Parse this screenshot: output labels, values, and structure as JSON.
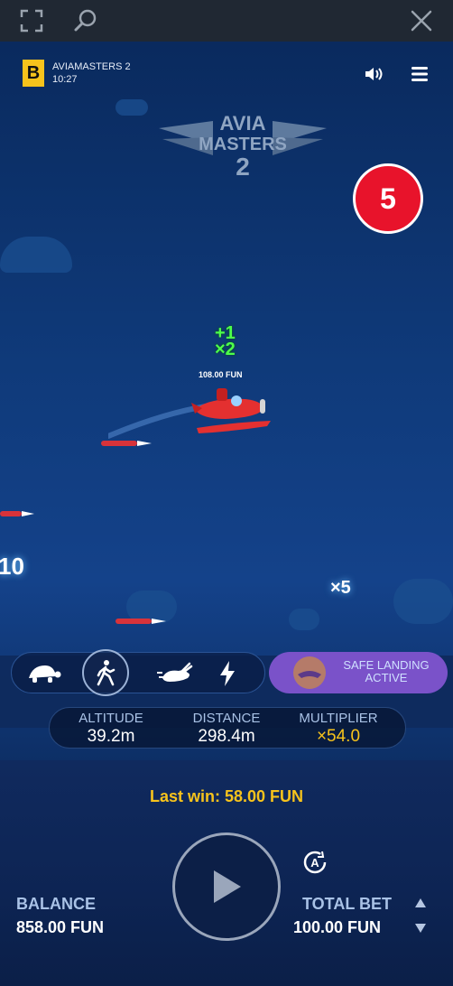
{
  "hud": {
    "brand_letter": "B",
    "game_name": "AVIAMASTERS 2",
    "time": "10:27"
  },
  "logo": {
    "line1": "AVIA",
    "line2": "MASTERS",
    "line3": "2"
  },
  "countdown": "5",
  "plane": {
    "bonus_add": "+1",
    "bonus_mult": "×2",
    "win_amount": "108.00 FUN"
  },
  "floating_multipliers": [
    "10",
    "×5"
  ],
  "speed_modes": [
    "turtle",
    "walk",
    "rabbit",
    "lightning"
  ],
  "active_speed": "walk",
  "safe_landing": {
    "line1": "SAFE LANDING",
    "line2": "ACTIVE"
  },
  "stats": {
    "altitude_label": "ALTITUDE",
    "altitude_value": "39.2m",
    "distance_label": "DISTANCE",
    "distance_value": "298.4m",
    "multiplier_label": "MULTIPLIER",
    "multiplier_value": "×54.0"
  },
  "last_win": "Last win: 58.00 FUN",
  "balance": {
    "label": "BALANCE",
    "value": "858.00 FUN"
  },
  "total_bet": {
    "label": "TOTAL BET",
    "value": "100.00 FUN"
  },
  "colors": {
    "accent_gold": "#f7c31c",
    "countdown_red": "#e8132b",
    "bonus_green": "#4dff4a",
    "safe_purple": "#7a52c9"
  }
}
